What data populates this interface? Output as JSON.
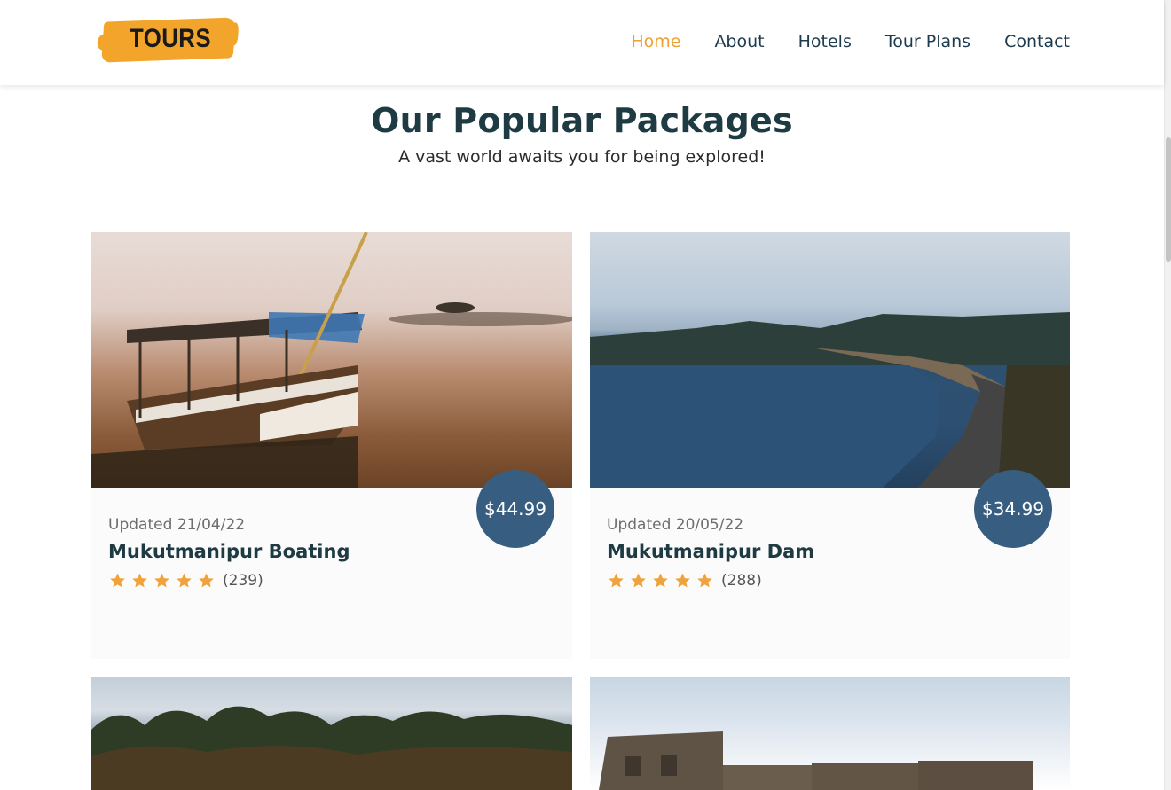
{
  "header": {
    "logo_text": "TOURS",
    "nav": [
      {
        "label": "Home",
        "active": true
      },
      {
        "label": "About",
        "active": false
      },
      {
        "label": "Hotels",
        "active": false
      },
      {
        "label": "Tour Plans",
        "active": false
      },
      {
        "label": "Contact",
        "active": false
      }
    ]
  },
  "section": {
    "title": "Our Popular Packages",
    "subtitle": "A vast world awaits you for being explored!"
  },
  "packages": [
    {
      "updated": "Updated 21/04/22",
      "title": "Mukutmanipur Boating",
      "price": "$44.99",
      "stars": 5,
      "reviews": "(239)"
    },
    {
      "updated": "Updated 20/05/22",
      "title": "Mukutmanipur Dam",
      "price": "$34.99",
      "stars": 5,
      "reviews": "(288)"
    }
  ],
  "colors": {
    "accent": "#ee9f33",
    "nav_text": "#1d3a4f",
    "price_badge": "#375e80",
    "star": "#f0a23b"
  }
}
